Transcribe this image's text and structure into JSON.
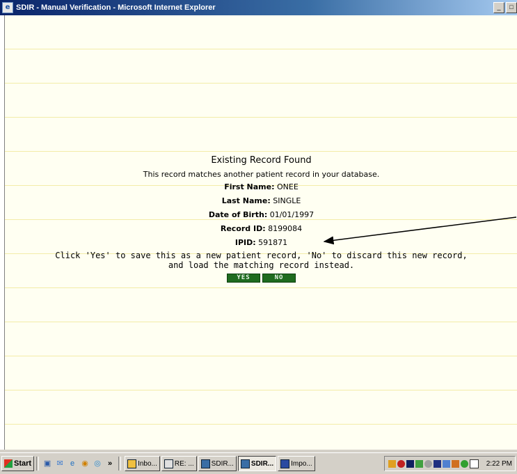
{
  "window": {
    "title": "SDIR - Manual Verification - Microsoft Internet Explorer",
    "minimize_label": "_",
    "maximize_label": "□"
  },
  "dialog": {
    "title": "Existing Record Found",
    "message": "This record matches another patient record in your database.",
    "fields": {
      "first_name": {
        "label": "First Name:",
        "value": "ONEE"
      },
      "last_name": {
        "label": "Last Name:",
        "value": "SINGLE"
      },
      "dob": {
        "label": "Date of Birth:",
        "value": "01/01/1997"
      },
      "record_id": {
        "label": "Record ID:",
        "value": "8199084"
      },
      "ipid": {
        "label": "IPID:",
        "value": "591871"
      }
    },
    "instructions_line1": "Click 'Yes' to save this as a new patient record, 'No' to discard this new record,",
    "instructions_line2": "and load the matching record instead.",
    "yes_label": "YES",
    "no_label": "NO"
  },
  "taskbar": {
    "start_label": "Start",
    "chevron": "»",
    "tasks": [
      {
        "label": "Inbo..."
      },
      {
        "label": "RE: ..."
      },
      {
        "label": "SDIR..."
      },
      {
        "label": "SDIR...",
        "active": true
      },
      {
        "label": "Impo..."
      }
    ],
    "tray_icons": [
      "shield-icon",
      "stop-icon",
      "square-icon",
      "monitor-icon",
      "globe-icon",
      "language-icon",
      "network-icon",
      "printer-icon",
      "clock-icon",
      "mail-icon"
    ],
    "clock": "2:22 PM"
  },
  "colors": {
    "title_bar": "#0a246a",
    "page_background": "#fffff2",
    "ruled_line": "#f3eca8",
    "button_green": "#1f6b1f"
  }
}
